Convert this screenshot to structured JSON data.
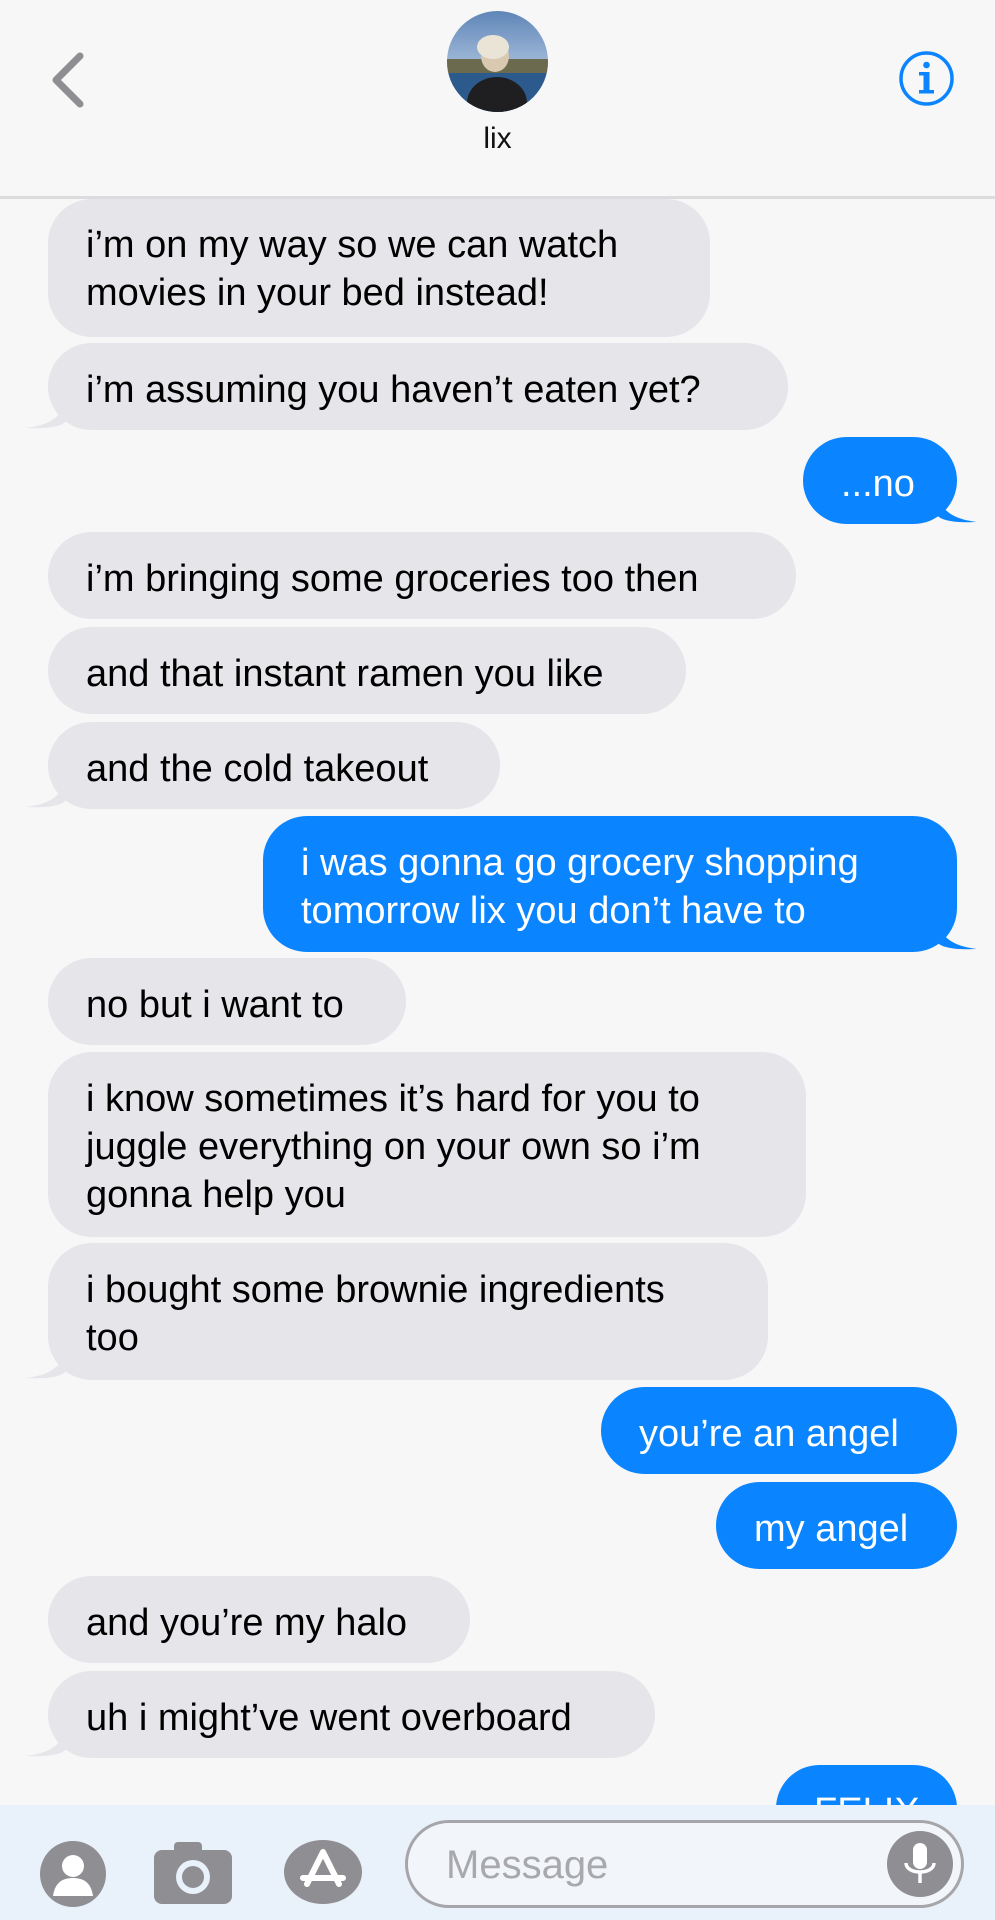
{
  "header": {
    "contact_name": "lix",
    "back_icon": "chevron-left-icon",
    "info_icon": "info-circle-icon",
    "colors": {
      "accent": "#0a84ff",
      "background": "#f7f7f8"
    }
  },
  "messages": [
    {
      "side": "received",
      "lines": [
        "i’m on my way so we can watch",
        "movies in your bed instead!"
      ]
    },
    {
      "side": "received",
      "lines": [
        "i’m assuming you haven’t eaten yet?"
      ]
    },
    {
      "side": "sent",
      "lines": [
        "...no"
      ]
    },
    {
      "side": "received",
      "lines": [
        "i’m bringing some groceries too then"
      ]
    },
    {
      "side": "received",
      "lines": [
        "and that instant ramen you like"
      ]
    },
    {
      "side": "received",
      "lines": [
        "and the cold takeout"
      ]
    },
    {
      "side": "sent",
      "lines": [
        "i was gonna go grocery shopping",
        "tomorrow lix you don’t have to"
      ]
    },
    {
      "side": "received",
      "lines": [
        "no but i want to"
      ]
    },
    {
      "side": "received",
      "lines": [
        "i know sometimes it’s hard for you to",
        "juggle everything on your own so i’m",
        "gonna help you"
      ]
    },
    {
      "side": "received",
      "lines": [
        "i bought some brownie ingredients",
        "too"
      ]
    },
    {
      "side": "sent",
      "lines": [
        "you’re an angel"
      ]
    },
    {
      "side": "sent",
      "lines": [
        "my angel"
      ]
    },
    {
      "side": "received",
      "lines": [
        "and you’re my halo"
      ]
    },
    {
      "side": "received",
      "lines": [
        "uh i might’ve went overboard"
      ]
    },
    {
      "side": "sent",
      "lines": [
        "FELIX"
      ]
    }
  ],
  "compose": {
    "placeholder": "Message",
    "icons": [
      "contact-icon",
      "camera-icon",
      "app-store-icon",
      "microphone-icon"
    ]
  }
}
